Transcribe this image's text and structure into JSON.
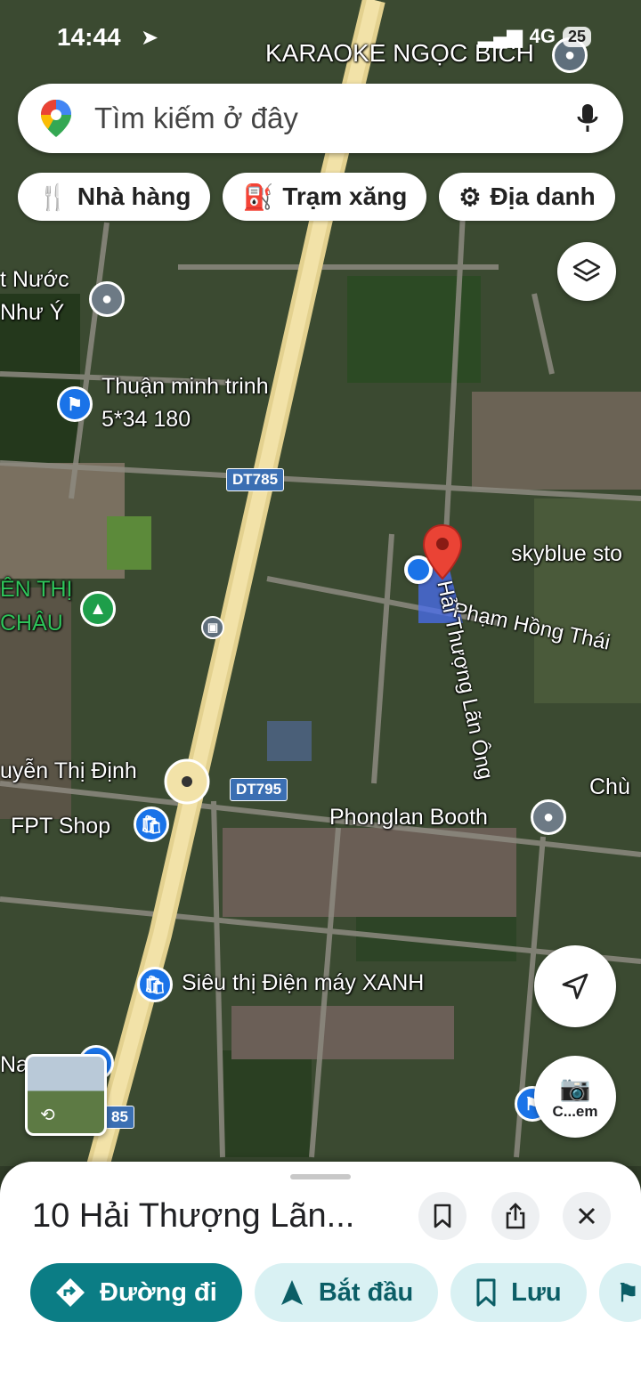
{
  "status_bar": {
    "time": "14:44",
    "network": "4G",
    "battery": "25"
  },
  "search": {
    "placeholder": "Tìm kiếm ở đây"
  },
  "chips": [
    {
      "label": "Nhà hàng",
      "icon": "restaurant-icon"
    },
    {
      "label": "Trạm xăng",
      "icon": "gas-station-icon"
    },
    {
      "label": "Địa danh",
      "icon": "landmark-icon"
    }
  ],
  "map": {
    "labels": {
      "karaoke": "KARAOKE NGỌC BÍCH",
      "nuoc": "t Nước",
      "nhu_y": "Như Ý",
      "thuan_1": "Thuận minh trinh",
      "thuan_2": "5*34 180",
      "road_dt785_a": "DT785",
      "road_dt785_b": "85",
      "road_dt795": "DT795",
      "skyblue": "skyblue sto",
      "pham_hong_thai": "Phạm Hồng Thái",
      "hai_thuong": "Hải Thượng Lãn Ông",
      "len_thi": "ÊN THỊ",
      "chau": "CHÂU",
      "nguyen_thi_dinh": "uyễn Thị Định",
      "fpt": "FPT Shop",
      "phonglan": "Phonglan Booth",
      "chu": "Chù",
      "sieu_thi": "Siêu thị Điện máy XANH",
      "na": "Na",
      "camera_label": "C...em"
    }
  },
  "sheet": {
    "title": "10 Hải Thượng Lãn...",
    "actions": {
      "directions": "Đường đi",
      "start": "Bắt đầu",
      "save": "Lưu"
    }
  },
  "colors": {
    "accent": "#0b7d85",
    "pin": "#ea4335",
    "location": "#1a73e8"
  }
}
